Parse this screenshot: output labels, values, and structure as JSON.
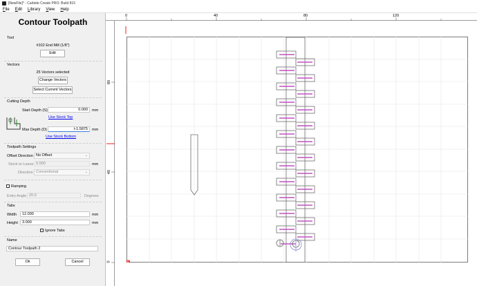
{
  "window": {
    "title": "[NewFile]* - Carbide Create PRO: Build 815"
  },
  "menu": [
    "File",
    "Edit",
    "Library",
    "View",
    "Help"
  ],
  "panel": {
    "title": "Contour Toolpath",
    "tool": {
      "heading": "Tool",
      "name": "#102 End Mill (1/8\")",
      "edit_label": "Edit"
    },
    "vectors": {
      "heading": "Vectors",
      "selected_text": "25 Vectors selected",
      "change_label": "Change Vectors",
      "select_current_label": "Select Current Vectors"
    },
    "cutting_depth": {
      "heading": "Cutting Depth",
      "start_label": "Start Depth (S)",
      "start_value": "0.000",
      "start_unit": "mm",
      "use_stock_top": "Use Stock Top",
      "max_label": "Max Depth (D)",
      "max_value": "t-1.5875",
      "max_unit": "mm",
      "use_stock_bottom": "Use Stock Bottom"
    },
    "toolpath_settings": {
      "heading": "Toolpath Settings",
      "offset_label": "Offset Direction",
      "offset_value": "No Offset",
      "stock_label": "Stock to Leave",
      "stock_value": "0.000",
      "stock_unit": "mm",
      "direction_label": "Direction",
      "direction_value": "Conventional"
    },
    "ramping": {
      "label": "Ramping",
      "entry_label": "Entry Angle",
      "entry_value": "20.0",
      "entry_unit": "Degrees"
    },
    "tabs": {
      "heading": "Tabs",
      "width_label": "Width",
      "width_value": "12.000",
      "width_unit": "mm",
      "height_label": "Height",
      "height_value": "3.000",
      "height_unit": "mm",
      "ignore_label": "Ignore Tabs"
    },
    "name": {
      "heading": "Name",
      "value": "Contour Toolpath 2"
    },
    "ok_label": "Ok",
    "cancel_label": "Cancel"
  },
  "ruler": {
    "top_labels": [
      "0",
      "40",
      "80",
      "120"
    ],
    "left_labels": [
      "80",
      "40",
      "0"
    ]
  },
  "colors": {
    "accent_red": "#e81c1c",
    "toolpath_magenta": "#c050c0",
    "outline_gray": "#6e6e6e"
  }
}
